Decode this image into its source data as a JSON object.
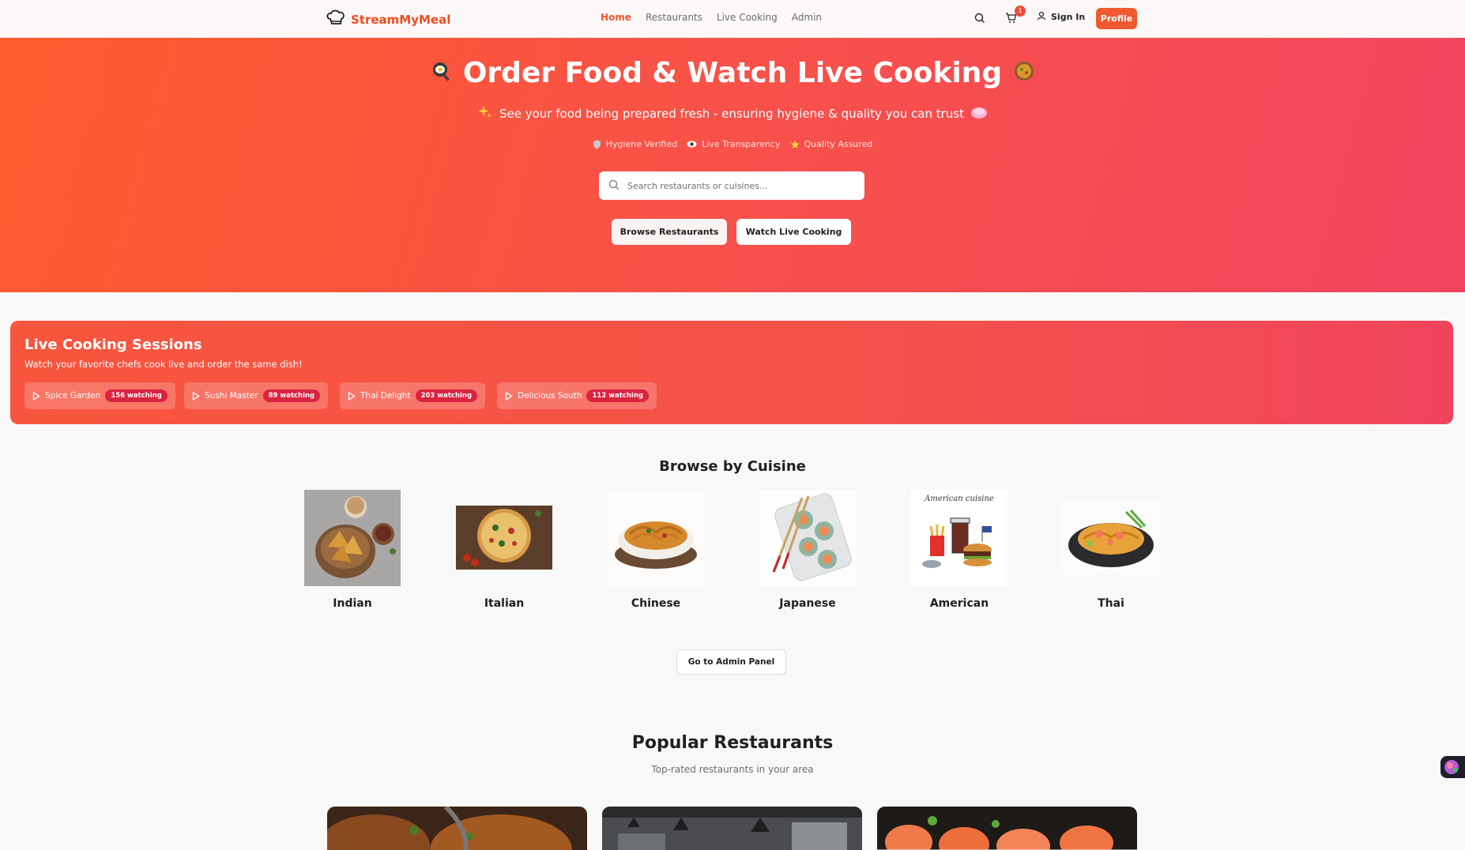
{
  "nav": {
    "brand": "StreamMyMeal",
    "links": [
      "Home",
      "Restaurants",
      "Live Cooking",
      "Admin"
    ],
    "cart_count": "1",
    "sign_in": "Sign In",
    "profile": "Profile"
  },
  "hero": {
    "title": "Order Food & Watch Live Cooking",
    "subtitle": "See your food being prepared fresh - ensuring hygiene & quality you can trust",
    "badges": [
      "Hygiene Verified",
      "Live Transparency",
      "Quality Assured"
    ],
    "search_placeholder": "Search restaurants or cuisines...",
    "browse_button": "Browse Restaurants",
    "watch_button": "Watch Live Cooking"
  },
  "live": {
    "title": "Live Cooking Sessions",
    "subtitle": "Watch your favorite chefs cook live and order the same dish!",
    "sessions": [
      {
        "name": "Spice Garden",
        "watching": "156 watching"
      },
      {
        "name": "Sushi Master",
        "watching": "89 watching"
      },
      {
        "name": "Thai Delight",
        "watching": "203 watching"
      },
      {
        "name": "Delicious South",
        "watching": "112 watching"
      }
    ]
  },
  "cuisines": {
    "title": "Browse by Cuisine",
    "items": [
      "Indian",
      "Italian",
      "Chinese",
      "Japanese",
      "American",
      "Thai"
    ],
    "american_caption": "American cuisine"
  },
  "admin_button": "Go to Admin Panel",
  "popular": {
    "title": "Popular Restaurants",
    "subtitle": "Top-rated restaurants in your area"
  },
  "colors": {
    "brand": "#ef4c23",
    "hero_start": "#ff5a2d",
    "hero_end": "#f2445e",
    "badge_red": "#d9233f"
  }
}
